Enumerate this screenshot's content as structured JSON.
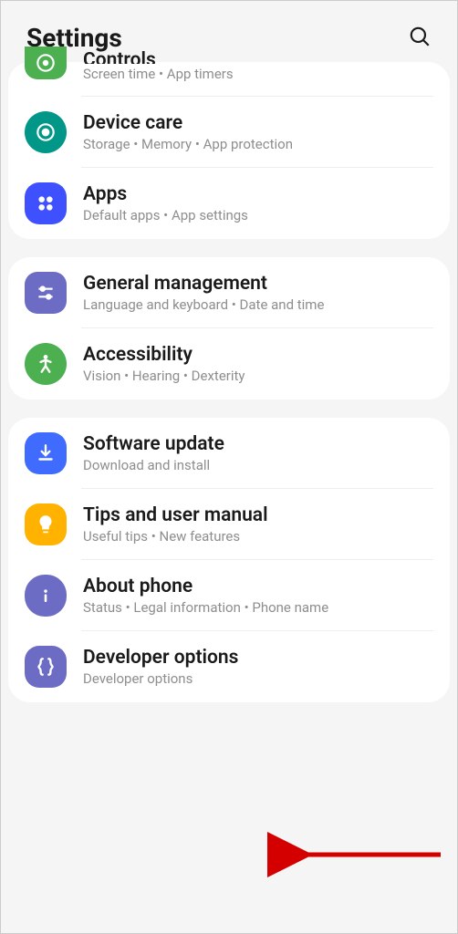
{
  "header": {
    "title": "Settings"
  },
  "groups": [
    {
      "items": [
        {
          "title": "Controls",
          "sub": "Screen time  •  App timers",
          "icon": "controls",
          "color": "#4caf50"
        },
        {
          "title": "Device care",
          "sub": "Storage  •  Memory  •  App protection",
          "icon": "device-care",
          "color": "#009688"
        },
        {
          "title": "Apps",
          "sub": "Default apps  •  App settings",
          "icon": "apps",
          "color": "#3f51ff"
        }
      ]
    },
    {
      "items": [
        {
          "title": "General management",
          "sub": "Language and keyboard  •  Date and time",
          "icon": "general",
          "color": "#6c6cc4"
        },
        {
          "title": "Accessibility",
          "sub": "Vision  •  Hearing  •  Dexterity",
          "icon": "accessibility",
          "color": "#4caf50"
        }
      ]
    },
    {
      "items": [
        {
          "title": "Software update",
          "sub": "Download and install",
          "icon": "software-update",
          "color": "#3f6bff"
        },
        {
          "title": "Tips and user manual",
          "sub": "Useful tips  •  New features",
          "icon": "tips",
          "color": "#ffb300"
        },
        {
          "title": "About phone",
          "sub": "Status  •  Legal information  •  Phone name",
          "icon": "about",
          "color": "#6c6cc4"
        },
        {
          "title": "Developer options",
          "sub": "Developer options",
          "icon": "developer",
          "color": "#6c6cc4"
        }
      ]
    }
  ]
}
